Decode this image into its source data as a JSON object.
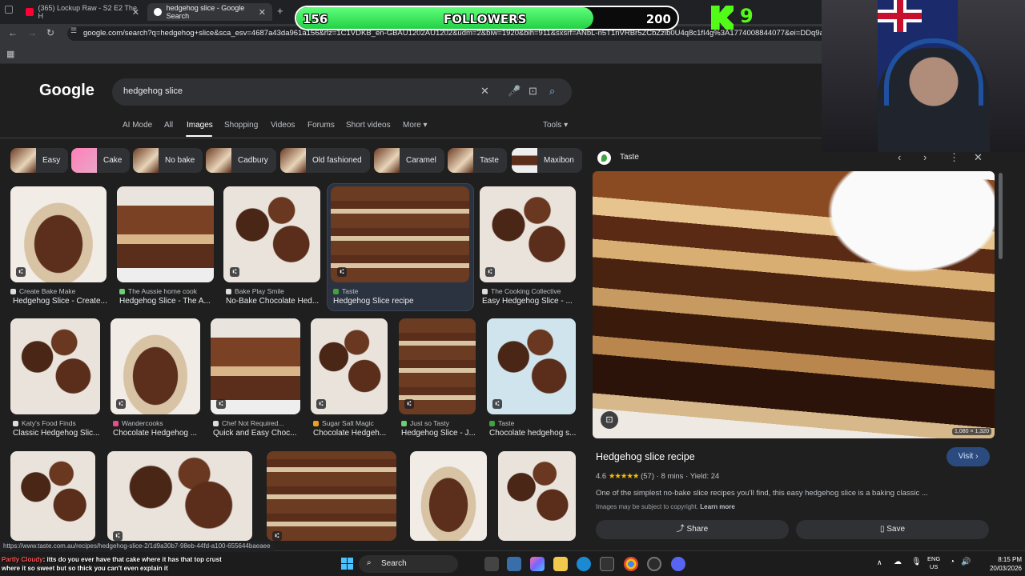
{
  "browser": {
    "tabs": [
      {
        "label": "(365) Lockup Raw - S2 E2 The H"
      },
      {
        "label": "hedgehog slice - Google Search"
      }
    ],
    "new_tab": "+",
    "url": "google.com/search?q=hedgehog+slice&sca_esv=4687a43da961a156&rlz=1C1VDKB_en-GBAU1202AU1202&udm=2&biw=1920&bih=911&sxsrf=ANbL-n5T1nVRBr5ZCbZzib0U4q8c1fI4g%3A1774008844077&ei=DDq9aaarBM"
  },
  "overlay": {
    "followers_current": "156",
    "followers_label": "FOLLOWERS",
    "followers_goal": "200",
    "followers_progress": 0.78,
    "kick_count": "9"
  },
  "google": {
    "logo": "Google",
    "query": "hedgehog slice",
    "nav_tabs": [
      "AI Mode",
      "All",
      "Images",
      "Shopping",
      "Videos",
      "Forums",
      "Short videos",
      "More ▾"
    ],
    "active_tab": "Images",
    "tools": "Tools ▾"
  },
  "chips": [
    "Easy",
    "Cake",
    "No bake",
    "Cadbury",
    "Old fashioned",
    "Caramel",
    "Taste",
    "Maxibon"
  ],
  "results": [
    {
      "source": "Create Bake Make",
      "title": "Hedgehog Slice - Create..."
    },
    {
      "source": "The Aussie home cook",
      "title": "Hedgehog Slice - The A..."
    },
    {
      "source": "Bake Play Smile",
      "title": "No-Bake Chocolate Hed..."
    },
    {
      "source": "Taste",
      "title": "Hedgehog Slice recipe"
    },
    {
      "source": "The Cooking Collective",
      "title": "Easy Hedgehog Slice - ..."
    },
    {
      "source": "Katy's Food Finds",
      "title": "Classic Hedgehog Slic..."
    },
    {
      "source": "Wandercooks",
      "title": "Chocolate Hedgehog ..."
    },
    {
      "source": "Chef Not Required...",
      "title": "Quick and Easy Choc..."
    },
    {
      "source": "Sugar Salt Magic",
      "title": "Chocolate Hedgeh..."
    },
    {
      "source": "Just so Tasty",
      "title": "Hedgehog Slice - J..."
    },
    {
      "source": "Taste",
      "title": "Chocolate hedgehog s..."
    }
  ],
  "panel": {
    "source": "Taste",
    "image_size": "1,080 × 1,320",
    "title": "Hedgehog slice recipe",
    "visit": "Visit ›",
    "rating": "4.6",
    "stars": "★★★★★",
    "reviews": "(57)",
    "time": "8 mins",
    "yield": "Yield: 24",
    "description": "One of the simplest no-bake slice recipes you'll find, this easy hedgehog slice is a baking classic ...",
    "copyright": "Images may be subject to copyright.",
    "learn_more": "Learn more",
    "share": "Share",
    "save": "Save"
  },
  "status_url": "https://www.taste.com.au/recipes/hedgehog-slice-2/1d9a30b7-98eb-44fd-a100-655644baeaee",
  "chat": {
    "user": "Partly Cloudy",
    "line1": ": itts do you ever have that cake where it has that top crust",
    "line2": "where it so sweet but so thick you can't even explain it"
  },
  "taskbar": {
    "search": "Search",
    "lang": "ENG",
    "region": "US",
    "time": "8:15 PM",
    "date": "20/03/2026"
  }
}
